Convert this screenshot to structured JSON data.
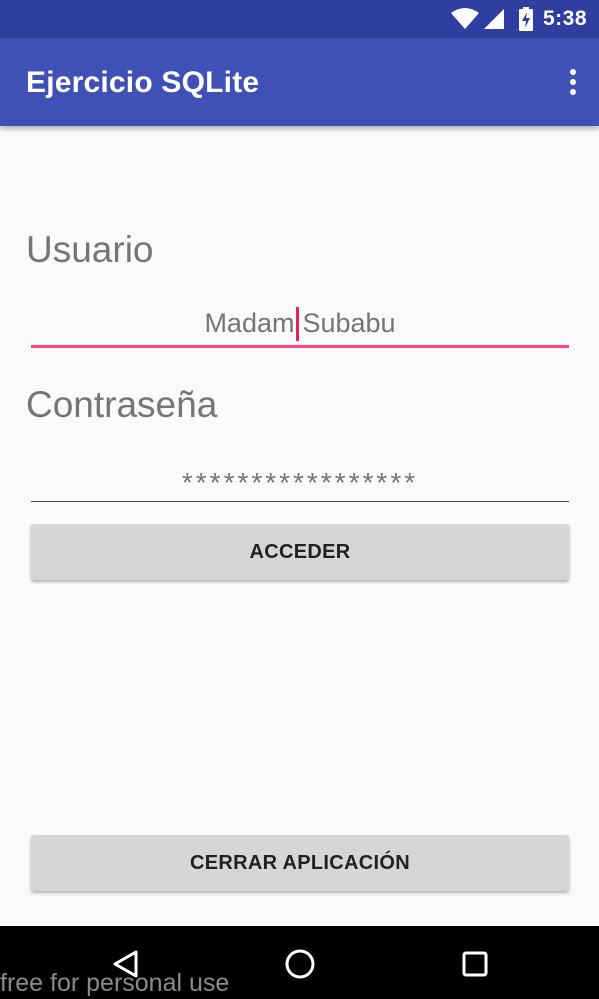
{
  "status_bar": {
    "time": "5:38",
    "icons": [
      "wifi-icon",
      "cell-signal-icon",
      "battery-charging-icon"
    ]
  },
  "app_bar": {
    "title": "Ejercicio SQLite",
    "overflow_icon": "more-vert-icon"
  },
  "form": {
    "user_label": "Usuario",
    "user_value_before_caret": "Madam",
    "user_value_after_caret": "Subabu",
    "password_label": "Contraseña",
    "password_value": "*****************",
    "login_button": "ACCEDER",
    "close_button": "CERRAR APLICACIÓN"
  },
  "nav_bar": {
    "icons": [
      "back-icon",
      "home-icon",
      "recent-apps-icon"
    ]
  },
  "watermark": "free for personal use",
  "colors": {
    "primary": "#3f51b5",
    "primary_dark": "#303f9f",
    "accent": "#ff4081",
    "background": "#fafafa",
    "button": "#d6d6d6"
  }
}
